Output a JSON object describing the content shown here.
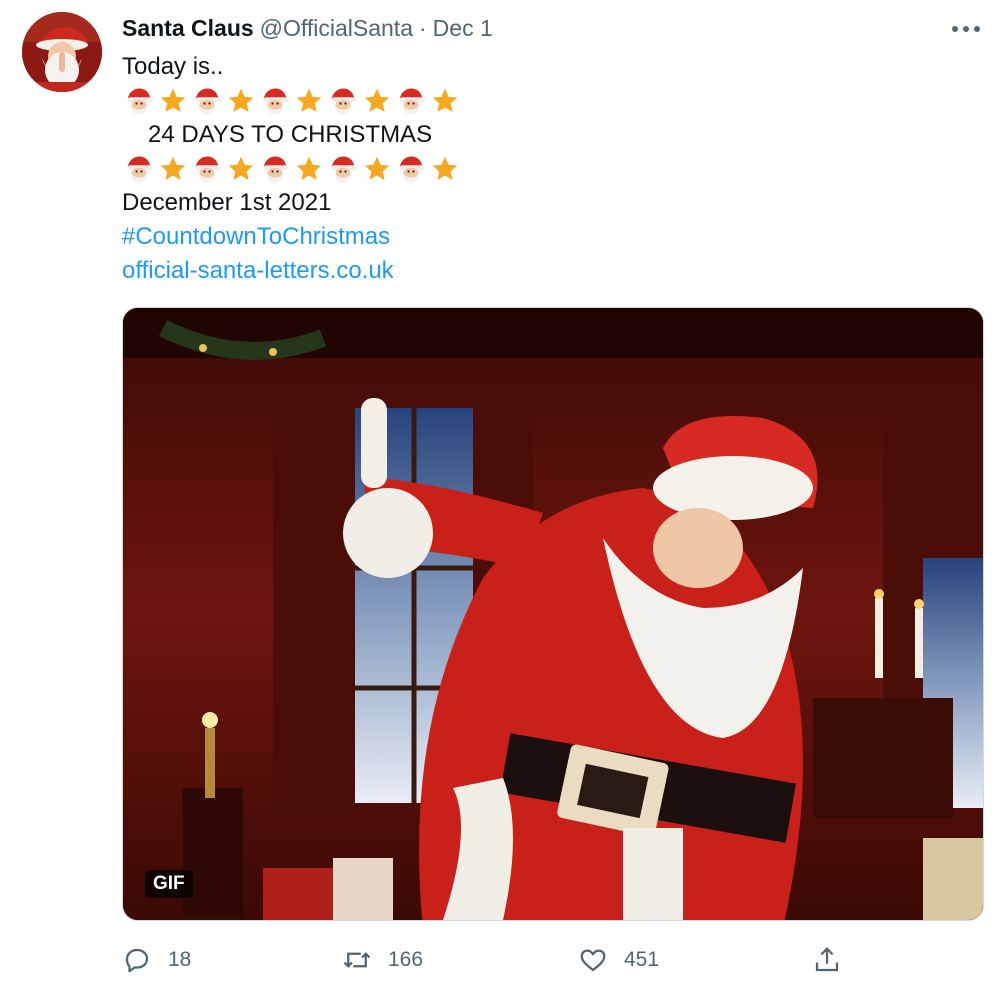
{
  "tweet": {
    "author_name": "Santa Claus",
    "handle": "@OfficialSanta",
    "separator": "·",
    "date": "Dec 1",
    "lines": {
      "intro": "Today is..",
      "headline": "24 DAYS TO CHRISTMAS",
      "date_text": "December 1st 2021",
      "hashtag": "#CountdownToChristmas",
      "url": "official-santa-letters.co.uk"
    },
    "emoji_pattern": [
      "santa-face-icon",
      "star-icon",
      "santa-face-icon",
      "star-icon",
      "santa-face-icon",
      "star-icon",
      "santa-face-icon",
      "star-icon",
      "santa-face-icon",
      "star-icon"
    ],
    "media": {
      "badge": "GIF",
      "description_icon": "santa-waving-gif"
    },
    "actions": {
      "reply_count": "18",
      "retweet_count": "166",
      "like_count": "451"
    }
  },
  "colors": {
    "link": "#1d9bf0",
    "secondary_text": "#536471",
    "star": "#f7a823",
    "santa_red": "#d62a22"
  }
}
